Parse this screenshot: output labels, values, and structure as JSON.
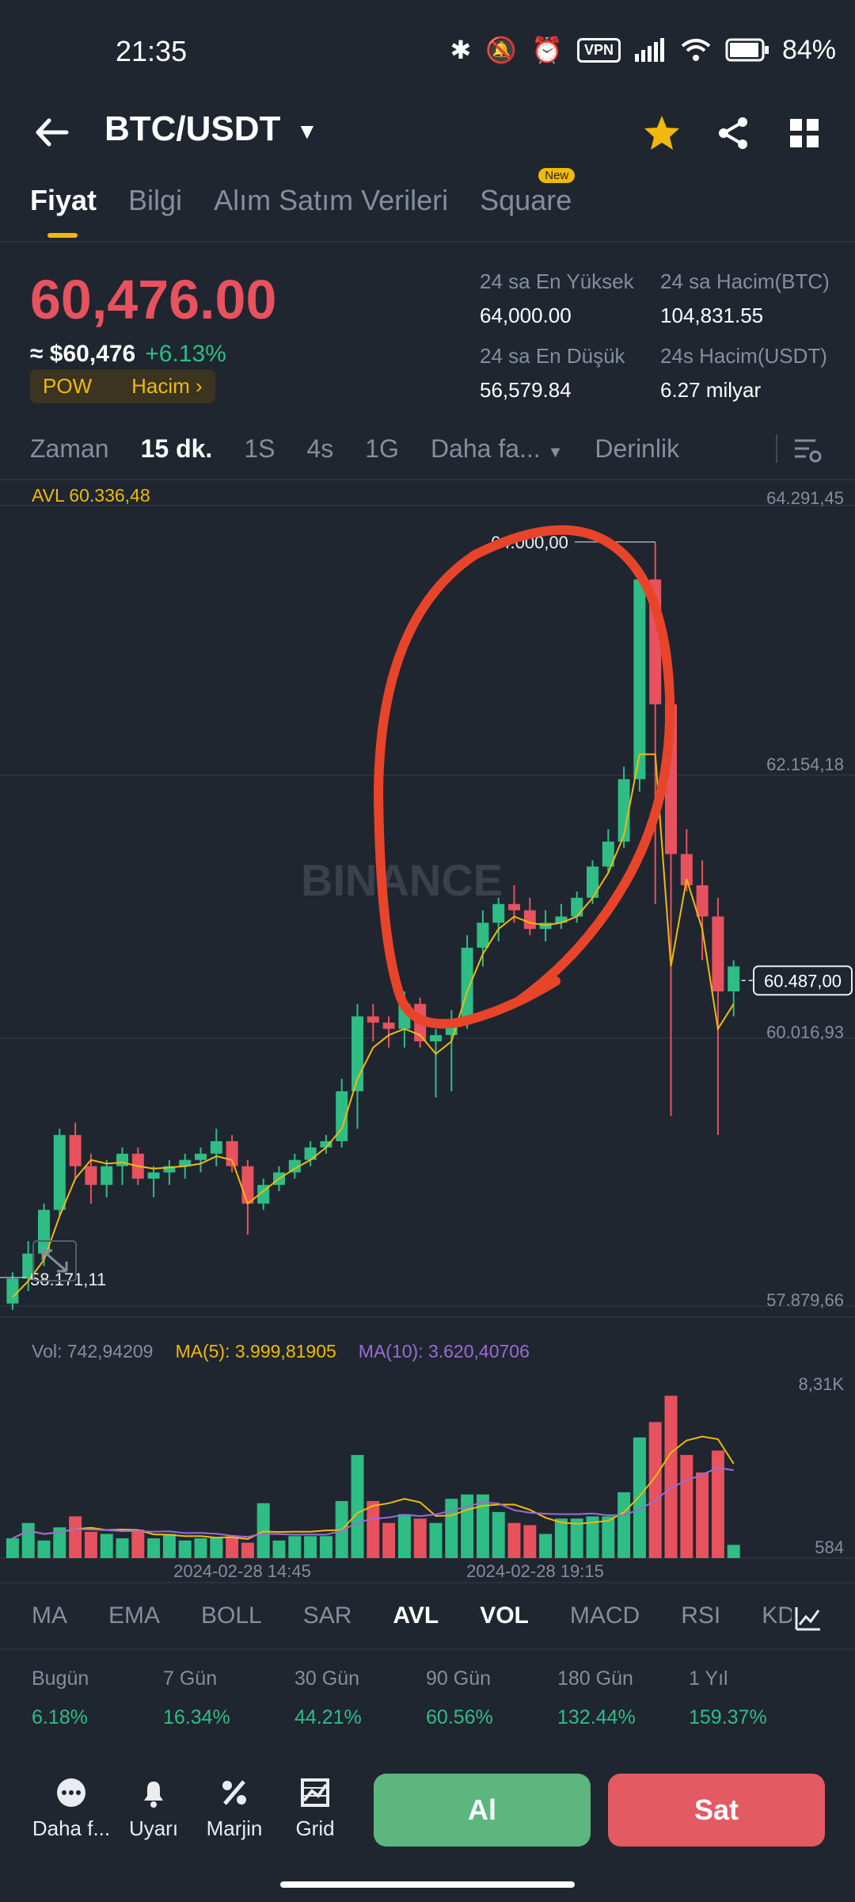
{
  "status": {
    "time": "21:35",
    "vpn": "VPN",
    "battery": "84%"
  },
  "header": {
    "pair": "BTC/USDT"
  },
  "tabs": [
    {
      "label": "Fiyat"
    },
    {
      "label": "Bilgi"
    },
    {
      "label": "Alım Satım Verileri"
    },
    {
      "label": "Square",
      "badge": "New"
    }
  ],
  "price": {
    "last": "60,476.00",
    "approx": "≈ $60,476",
    "change": "+6.13%",
    "tag1": "POW",
    "tag2": "Hacim"
  },
  "stats": {
    "high_label": "24 sa En Yüksek",
    "high": "64,000.00",
    "vol_btc_label": "24 sa Hacim(BTC)",
    "vol_btc": "104,831.55",
    "low_label": "24 sa En Düşük",
    "low": "56,579.84",
    "vol_usdt_label": "24s Hacim(USDT)",
    "vol_usdt": "6.27 milyar"
  },
  "timeframes": [
    "Zaman",
    "15 dk.",
    "1S",
    "4s",
    "1G",
    "Daha fa...",
    "Derinlik"
  ],
  "chart": {
    "avl_legend": "AVL 60.336,48",
    "y_labels": [
      "64.291,45",
      "62.154,18",
      "60.016,93",
      "57.879,66"
    ],
    "current_price": "60.487,00",
    "max_label": "64.000,00",
    "min_label": "58.171,11",
    "vol_legend": {
      "vol": "Vol: 742,94209",
      "ma5": "MA(5): 3.999,81905",
      "ma10": "MA(10): 3.620,40706"
    },
    "vol_y_labels": [
      "8,31K",
      "584"
    ],
    "x_labels": [
      "2024-02-28 14:45",
      "2024-02-28 19:15"
    ],
    "watermark": "BINANCE",
    "colors": {
      "up": "#2ebd85",
      "down": "#e7525e",
      "avl": "#f0b90b",
      "ma10": "#9b6bd6",
      "annotation": "#e8442a"
    }
  },
  "indicators": [
    "MA",
    "EMA",
    "BOLL",
    "SAR",
    "AVL",
    "VOL",
    "MACD",
    "RSI",
    "KDJ"
  ],
  "performance": [
    {
      "label": "Bugün",
      "value": "6.18%"
    },
    {
      "label": "7 Gün",
      "value": "16.34%"
    },
    {
      "label": "30 Gün",
      "value": "44.21%"
    },
    {
      "label": "90 Gün",
      "value": "60.56%"
    },
    {
      "label": "180 Gün",
      "value": "132.44%"
    },
    {
      "label": "1 Yıl",
      "value": "159.37%"
    }
  ],
  "bottom": {
    "more": "Daha f...",
    "alert": "Uyarı",
    "margin": "Marjin",
    "grid": "Grid",
    "buy": "Al",
    "sell": "Sat"
  },
  "chart_data": {
    "type": "candlestick",
    "ohlc": [
      [
        57900,
        58150,
        57850,
        58100
      ],
      [
        58100,
        58400,
        58000,
        58300
      ],
      [
        58300,
        58700,
        58200,
        58650
      ],
      [
        58650,
        59300,
        58600,
        59250
      ],
      [
        59250,
        59350,
        58900,
        59000
      ],
      [
        59000,
        59100,
        58700,
        58850
      ],
      [
        58850,
        59050,
        58750,
        59000
      ],
      [
        59000,
        59150,
        58850,
        59100
      ],
      [
        59100,
        59150,
        58850,
        58900
      ],
      [
        58900,
        59000,
        58750,
        58950
      ],
      [
        58950,
        59050,
        58850,
        59000
      ],
      [
        59000,
        59100,
        58900,
        59050
      ],
      [
        59050,
        59150,
        58950,
        59100
      ],
      [
        59100,
        59300,
        59000,
        59200
      ],
      [
        59200,
        59250,
        58950,
        59000
      ],
      [
        59000,
        59050,
        58450,
        58700
      ],
      [
        58700,
        58900,
        58650,
        58850
      ],
      [
        58850,
        59000,
        58800,
        58950
      ],
      [
        58950,
        59100,
        58900,
        59050
      ],
      [
        59050,
        59200,
        59000,
        59150
      ],
      [
        59150,
        59250,
        59100,
        59200
      ],
      [
        59200,
        59700,
        59150,
        59600
      ],
      [
        59600,
        60300,
        59300,
        60200
      ],
      [
        60200,
        60300,
        60000,
        60150
      ],
      [
        60150,
        60200,
        59950,
        60100
      ],
      [
        60100,
        60400,
        59950,
        60300
      ],
      [
        60300,
        60350,
        59950,
        60000
      ],
      [
        60000,
        60100,
        59550,
        60050
      ],
      [
        60050,
        60250,
        59600,
        60150
      ],
      [
        60150,
        60850,
        60100,
        60750
      ],
      [
        60750,
        61050,
        60600,
        60950
      ],
      [
        60950,
        61150,
        60800,
        61100
      ],
      [
        61100,
        61250,
        60950,
        61050
      ],
      [
        61050,
        61150,
        60850,
        60900
      ],
      [
        60900,
        61050,
        60800,
        60950
      ],
      [
        60950,
        61100,
        60900,
        61000
      ],
      [
        61000,
        61200,
        60950,
        61150
      ],
      [
        61150,
        61450,
        61100,
        61400
      ],
      [
        61400,
        61700,
        61350,
        61600
      ],
      [
        61600,
        62200,
        61550,
        62100
      ],
      [
        62100,
        63800,
        62000,
        63700
      ],
      [
        63700,
        64000,
        61100,
        62700
      ],
      [
        62700,
        62800,
        59400,
        61500
      ],
      [
        61500,
        61700,
        61200,
        61250
      ],
      [
        61250,
        61450,
        60650,
        61000
      ],
      [
        61000,
        61150,
        59250,
        60400
      ],
      [
        60400,
        60650,
        60200,
        60600
      ]
    ],
    "volume": [
      900,
      1600,
      800,
      1400,
      1900,
      1200,
      1100,
      900,
      1300,
      900,
      1100,
      800,
      900,
      950,
      1000,
      700,
      2500,
      800,
      1000,
      1000,
      1000,
      2600,
      4700,
      2600,
      1600,
      2000,
      1800,
      1600,
      2700,
      2900,
      2900,
      2100,
      1600,
      1500,
      1100,
      1800,
      1800,
      1900,
      1900,
      3000,
      5500,
      6200,
      7400,
      4700,
      3900,
      4900,
      600
    ],
    "avl": [
      57950,
      58080,
      58250,
      58600,
      58900,
      59050,
      59020,
      59030,
      59000,
      58980,
      58990,
      59000,
      59020,
      59080,
      59050,
      58700,
      58800,
      58900,
      58980,
      59050,
      59150,
      59300,
      59700,
      59950,
      60050,
      60100,
      60050,
      59900,
      60000,
      60400,
      60700,
      60900,
      61000,
      60950,
      60930,
      60950,
      61000,
      61150,
      61350,
      61650,
      62300,
      62300,
      60600,
      61300,
      60900,
      60100,
      60300
    ],
    "y_range": [
      57879.66,
      64291.45
    ],
    "vol_max": 8310
  }
}
